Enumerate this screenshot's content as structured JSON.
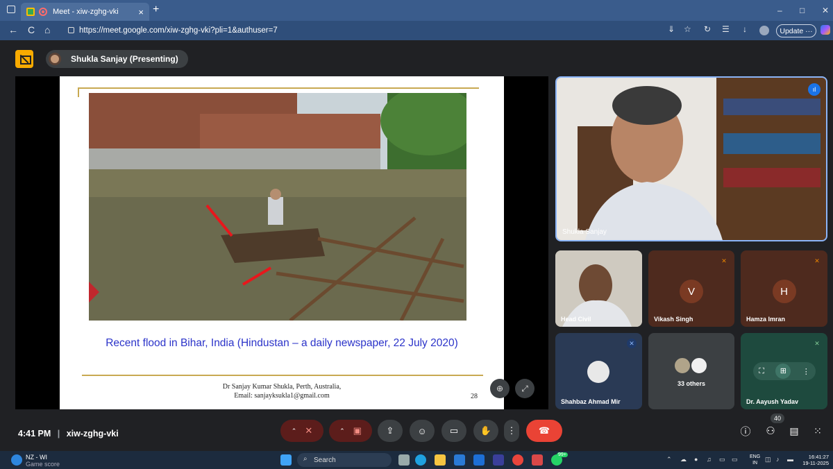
{
  "browser": {
    "tab_title": "Meet - xiw-zghg-vki",
    "tab_close": "×",
    "new_tab": "+",
    "url": "https://meet.google.com/xiw-zghg-vki?pli=1&authuser=7",
    "update_label": "Update",
    "update_more": "···",
    "nav_back": "←",
    "nav_refresh": "C",
    "nav_home": "⌂",
    "win_min": "–",
    "win_max": "□",
    "win_close": "✕"
  },
  "meet": {
    "presenter_label": "Shukla Sanjay (Presenting)",
    "slide": {
      "caption": "Recent flood in Bihar, India  (Hindustan – a daily newspaper, 22 July 2020)",
      "footer_line1": "Dr Sanjay Kumar Shukla, Perth, Australia,",
      "footer_line2": "Email: sanjayksukla1@gmail.com",
      "page_number": "28"
    },
    "main_tile_name": "Shukla Sanjay",
    "tiles": [
      {
        "name": "Head Civil"
      },
      {
        "name": "Vikash Singh",
        "initial": "V"
      },
      {
        "name": "Hamza Imran",
        "initial": "H"
      },
      {
        "name": "Shahbaz Ahmad Mir"
      },
      {
        "name": "33 others"
      },
      {
        "name": "Dr. Aayush Yadav"
      }
    ],
    "time": "4:41 PM",
    "meeting_code": "xiw-zghg-vki",
    "participant_count": "40",
    "colors": {
      "end_call": "#ea4335",
      "muted_control": "#5c1d1b",
      "accent": "#8ab4f8",
      "present_badge": "#f9ab00"
    }
  },
  "taskbar": {
    "weather_line1": "NZ - WI",
    "weather_line2": "Game score",
    "search_placeholder": "Search",
    "whatsapp_badge": "99+",
    "lang_line1": "ENG",
    "lang_line2": "IN",
    "clock_time": "16:41:27",
    "clock_date": "19-11-2025"
  }
}
